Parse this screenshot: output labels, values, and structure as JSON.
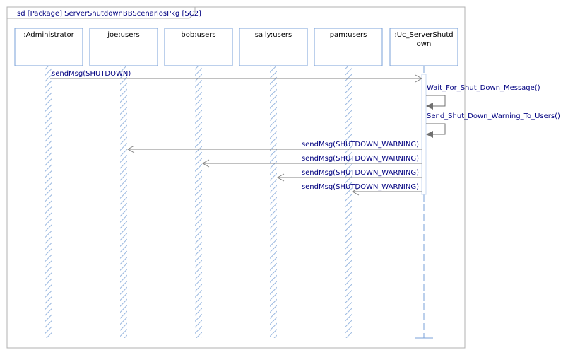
{
  "frame": {
    "label": "sd [Package] ServerShutdownBBScenariosPkg [SC2]"
  },
  "lifelines": [
    {
      "label_lines": [
        ":Administrator"
      ]
    },
    {
      "label_lines": [
        "joe:users"
      ]
    },
    {
      "label_lines": [
        "bob:users"
      ]
    },
    {
      "label_lines": [
        "sally:users"
      ]
    },
    {
      "label_lines": [
        "pam:users"
      ]
    },
    {
      "label_lines": [
        ":Uc_ServerShutd",
        "own"
      ]
    }
  ],
  "messages": [
    {
      "label": "sendMsg(SHUTDOWN)",
      "from": 0,
      "to": 5
    },
    {
      "label": "Wait_For_Shut_Down_Message()",
      "from": 5,
      "to": 5
    },
    {
      "label": "Send_Shut_Down_Warning_To_Users()",
      "from": 5,
      "to": 5
    },
    {
      "label": "sendMsg(SHUTDOWN_WARNING)",
      "from": 5,
      "to": 1
    },
    {
      "label": "sendMsg(SHUTDOWN_WARNING)",
      "from": 5,
      "to": 2
    },
    {
      "label": "sendMsg(SHUTDOWN_WARNING)",
      "from": 5,
      "to": 3
    },
    {
      "label": "sendMsg(SHUTDOWN_WARNING)",
      "from": 5,
      "to": 4
    }
  ],
  "colors": {
    "label_text": "#000080",
    "line": "#808080",
    "hatch": "#9ab8e0",
    "self_arrow": "#707070",
    "box_border": "#7aa0d8"
  }
}
